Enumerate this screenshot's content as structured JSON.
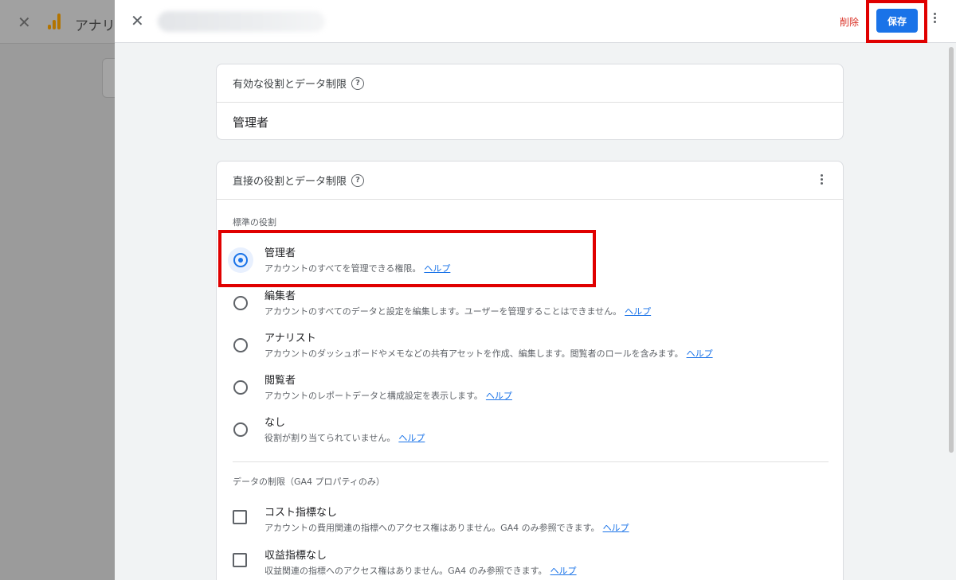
{
  "background": {
    "app_title": "アナリ"
  },
  "header": {
    "delete_label": "削除",
    "save_label": "保存"
  },
  "effective_card": {
    "title": "有効な役割とデータ制限",
    "role": "管理者"
  },
  "direct_card": {
    "title": "直接の役割とデータ制限",
    "standard_roles_label": "標準の役割",
    "help_text": "ヘルプ",
    "roles": [
      {
        "name": "管理者",
        "description": "アカウントのすべてを管理できる権限。",
        "selected": true
      },
      {
        "name": "編集者",
        "description": "アカウントのすべてのデータと設定を編集します。ユーザーを管理することはできません。",
        "selected": false
      },
      {
        "name": "アナリスト",
        "description": "アカウントのダッシュボードやメモなどの共有アセットを作成、編集します。閲覧者のロールを含みます。",
        "selected": false
      },
      {
        "name": "閲覧者",
        "description": "アカウントのレポートデータと構成設定を表示します。",
        "selected": false
      },
      {
        "name": "なし",
        "description": "役割が割り当てられていません。",
        "selected": false
      }
    ],
    "data_restrictions_label": "データの制限（GA4 プロパティのみ）",
    "restrictions": [
      {
        "name": "コスト指標なし",
        "description": "アカウントの費用関連の指標へのアクセス権はありません。GA4 のみ参照できます。",
        "checked": false
      },
      {
        "name": "収益指標なし",
        "description": "収益関連の指標へのアクセス権はありません。GA4 のみ参照できます。",
        "checked": false
      }
    ]
  },
  "icons": {
    "close": "close-icon",
    "help": "help-circle-icon",
    "more": "more-vert-icon",
    "logo": "analytics-logo-icon"
  },
  "colors": {
    "accent": "#1a73e8",
    "danger": "#d93025",
    "highlight": "#e00000"
  }
}
